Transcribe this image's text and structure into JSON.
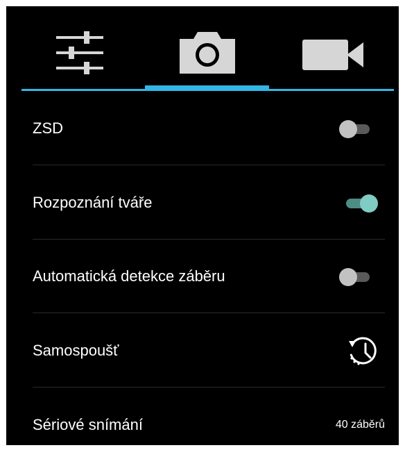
{
  "tabs": [
    {
      "icon": "sliders-icon",
      "name": "tab-settings",
      "selected": false
    },
    {
      "icon": "camera-icon",
      "name": "tab-camera",
      "selected": true
    },
    {
      "icon": "video-camera-icon",
      "name": "tab-video",
      "selected": false
    }
  ],
  "settings": {
    "zsd": {
      "label": "ZSD",
      "enabled": false
    },
    "face_detection": {
      "label": "Rozpoznání tváře",
      "enabled": true
    },
    "auto_scene": {
      "label": "Automatická detekce záběru",
      "enabled": false
    },
    "self_timer": {
      "label": "Samospoušť",
      "icon": "timer-icon"
    },
    "burst": {
      "label": "Sériové snímání",
      "value": "40 záběrů"
    }
  },
  "colors": {
    "background": "#000000",
    "accent": "#33b5e5",
    "switch_on_thumb": "#80cbc4",
    "switch_on_track": "#4e8c86",
    "switch_off_thumb": "#c2c2c2",
    "switch_off_track": "#5a5a5a",
    "icon": "#d6d6d6",
    "text": "#ffffff"
  }
}
